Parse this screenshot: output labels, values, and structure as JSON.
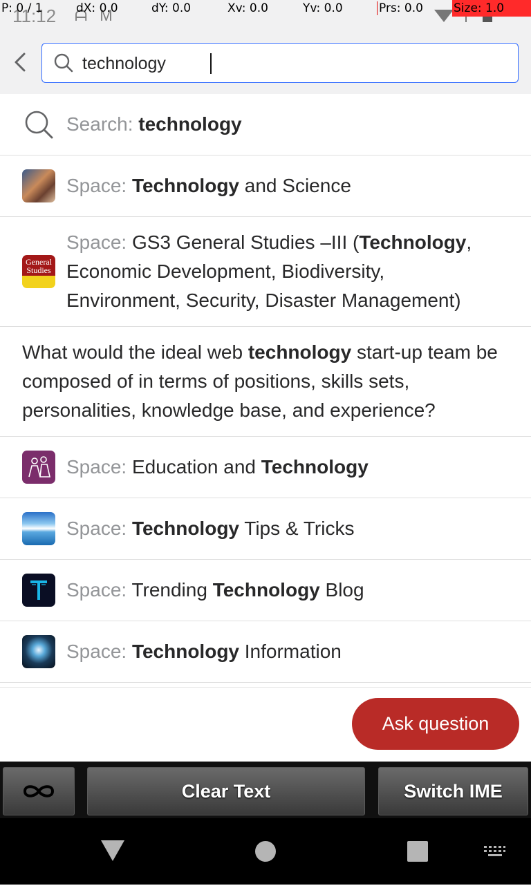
{
  "status_bar": {
    "time": "11:12",
    "left_icons": "ᗩ M",
    "overlay": {
      "p": "P: 0 / 1",
      "dx": "dX: 0.0",
      "dy": "dY: 0.0",
      "xv": "Xv: 0.0",
      "yv": "Yv: 0.0",
      "prs": "Prs: 0.0",
      "size": "Size: 1.0"
    }
  },
  "header": {
    "search_value": "technology"
  },
  "results": [
    {
      "prefix": "Search: ",
      "parts": [
        {
          "t": "technology",
          "b": true
        }
      ]
    },
    {
      "prefix": "Space: ",
      "parts": [
        {
          "t": "Technology",
          "b": true
        },
        {
          "t": " and Science",
          "b": false
        }
      ]
    },
    {
      "prefix": "Space: ",
      "parts": [
        {
          "t": "GS3 General Studies –III (",
          "b": false
        },
        {
          "t": "Technology",
          "b": true
        },
        {
          "t": ", Economic Development, Biodiversity, Environment, Security, Disaster Management)",
          "b": false
        }
      ]
    },
    {
      "prefix": "",
      "parts": [
        {
          "t": "What would the ideal web ",
          "b": false
        },
        {
          "t": "technology",
          "b": true
        },
        {
          "t": " start-up team be composed of in terms of positions, skills sets, personalities, knowledge base, and experience?",
          "b": false
        }
      ]
    },
    {
      "prefix": "Space: ",
      "parts": [
        {
          "t": "Education and ",
          "b": false
        },
        {
          "t": "Technology",
          "b": true
        }
      ]
    },
    {
      "prefix": "Space: ",
      "parts": [
        {
          "t": "Technology",
          "b": true
        },
        {
          "t": " Tips & Tricks",
          "b": false
        }
      ]
    },
    {
      "prefix": "Space: ",
      "parts": [
        {
          "t": "Trending ",
          "b": false
        },
        {
          "t": "Technology",
          "b": true
        },
        {
          "t": " Blog",
          "b": false
        }
      ]
    },
    {
      "prefix": "Space: ",
      "parts": [
        {
          "t": "Technology",
          "b": true
        },
        {
          "t": " Information",
          "b": false
        }
      ]
    }
  ],
  "icons": {
    "gs3_icon_text": "General Studies"
  },
  "ask_button": "Ask question",
  "keyboard_bar": {
    "clear": "Clear Text",
    "switch": "Switch IME",
    "infinity_icon": "∞"
  },
  "colors": {
    "accent_blue": "#2e69ff",
    "ask_red": "#b92b27",
    "muted_label": "#939598"
  }
}
